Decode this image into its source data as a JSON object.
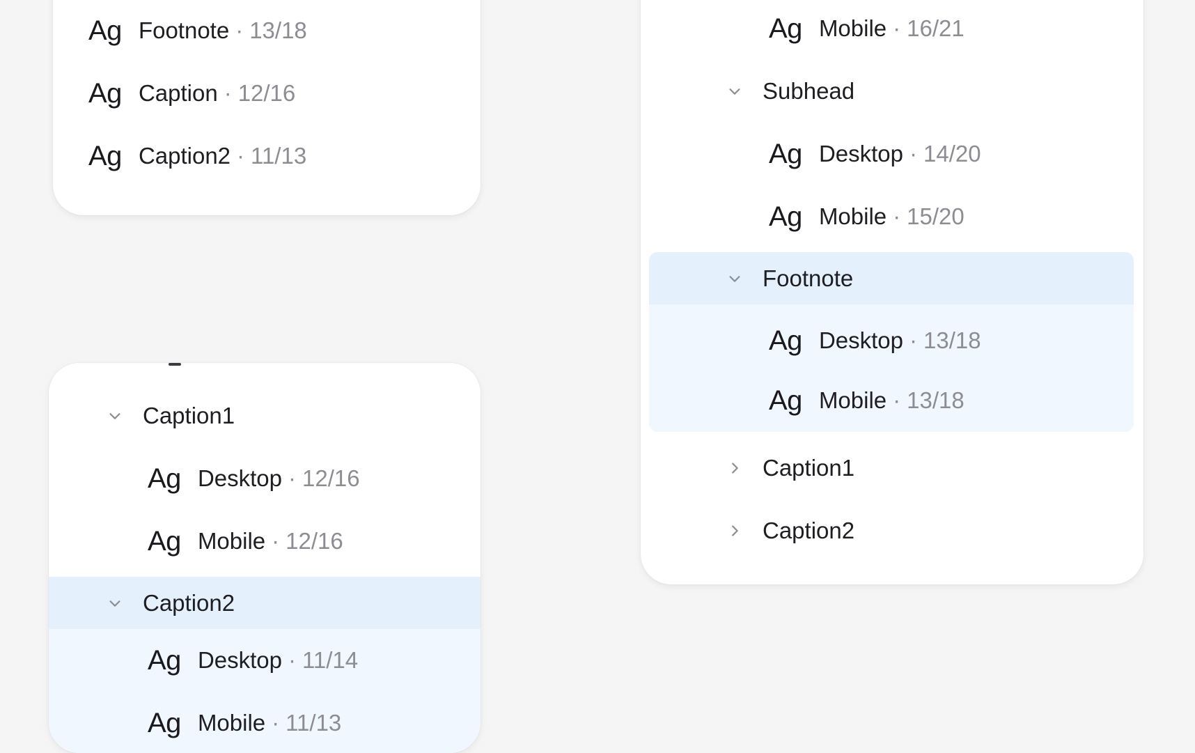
{
  "panel_top_left": {
    "items": [
      {
        "glyph": "Ag",
        "label": "Footnote",
        "sep": "·",
        "size": "13/18"
      },
      {
        "glyph": "Ag",
        "label": "Caption",
        "sep": "·",
        "size": "12/16"
      },
      {
        "glyph": "Ag",
        "label": "Caption2",
        "sep": "·",
        "size": "11/13"
      }
    ]
  },
  "panel_bottom_left": {
    "groups": [
      {
        "label": "Caption1",
        "icon": "chevron-down-icon",
        "items": [
          {
            "glyph": "Ag",
            "label": "Desktop",
            "sep": "·",
            "size": "12/16"
          },
          {
            "glyph": "Ag",
            "label": "Mobile",
            "sep": "·",
            "size": "12/16"
          }
        ]
      },
      {
        "label": "Caption2",
        "icon": "chevron-down-icon",
        "selected": true,
        "items": [
          {
            "glyph": "Ag",
            "label": "Desktop",
            "sep": "·",
            "size": "11/14"
          },
          {
            "glyph": "Ag",
            "label": "Mobile",
            "sep": "·",
            "size": "11/13"
          }
        ]
      }
    ]
  },
  "panel_right": {
    "top_item": {
      "glyph": "Ag",
      "label": "Mobile",
      "sep": "·",
      "size": "16/21"
    },
    "groups": [
      {
        "label": "Subhead",
        "icon": "chevron-down-icon",
        "items": [
          {
            "glyph": "Ag",
            "label": "Desktop",
            "sep": "·",
            "size": "14/20"
          },
          {
            "glyph": "Ag",
            "label": "Mobile",
            "sep": "·",
            "size": "15/20"
          }
        ]
      },
      {
        "label": "Footnote",
        "icon": "chevron-down-icon",
        "selected": true,
        "items": [
          {
            "glyph": "Ag",
            "label": "Desktop",
            "sep": "·",
            "size": "13/18"
          },
          {
            "glyph": "Ag",
            "label": "Mobile",
            "sep": "·",
            "size": "13/18"
          }
        ]
      },
      {
        "label": "Caption1",
        "icon": "chevron-right-icon",
        "items": []
      },
      {
        "label": "Caption2",
        "icon": "chevron-right-icon",
        "items": []
      }
    ]
  },
  "colors": {
    "selected_header": "#e4f1fd",
    "selected_group": "#f1f7ff",
    "text_primary": "#1e1e22",
    "text_muted": "#8c8c93"
  }
}
